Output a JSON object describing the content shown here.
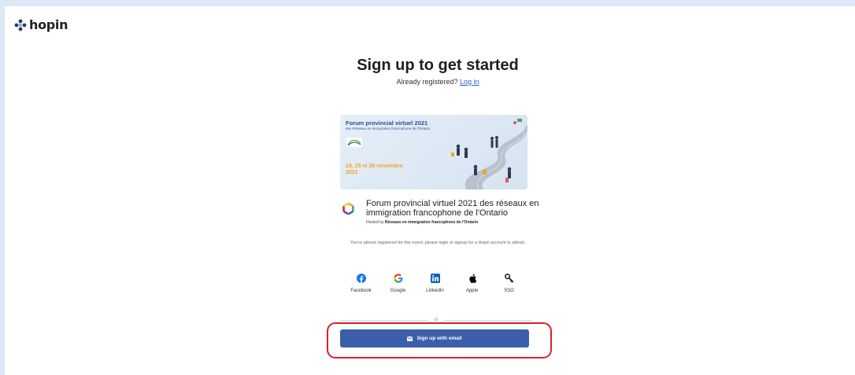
{
  "brand": {
    "name": "hopin"
  },
  "header": {
    "title": "Sign up to get started",
    "already_registered": "Already registered?",
    "login_link": "Log in"
  },
  "banner": {
    "title": "Forum provincial virtuel 2021",
    "subtitle": "des Réseaux en immigration francophone de l'Ontario",
    "dates": "24, 25 et 26 novembre 2021"
  },
  "event": {
    "name": "Forum provincial virtuel 2021 des réseaux en immigration francophone de l'Ontario",
    "hosted_by": "Hosted by",
    "host": "Réseaux en immigration francophone de l'Ontario"
  },
  "note": "You're almost registered for this event, please login or signup for a Hopin account to attend.",
  "socials": [
    {
      "label": "Facebook",
      "icon": "facebook-icon",
      "color": "#1877f2"
    },
    {
      "label": "Google",
      "icon": "google-icon",
      "color": "#4285f4"
    },
    {
      "label": "LinkedIn",
      "icon": "linkedin-icon",
      "color": "#0a66c2"
    },
    {
      "label": "Apple",
      "icon": "apple-icon",
      "color": "#000000"
    },
    {
      "label": "SSO",
      "icon": "key-icon",
      "color": "#222222"
    }
  ],
  "divider_text": "Or",
  "email_button": {
    "label": "Sign up with email",
    "color": "#3c5fac"
  },
  "highlight_color": "#d9212c"
}
